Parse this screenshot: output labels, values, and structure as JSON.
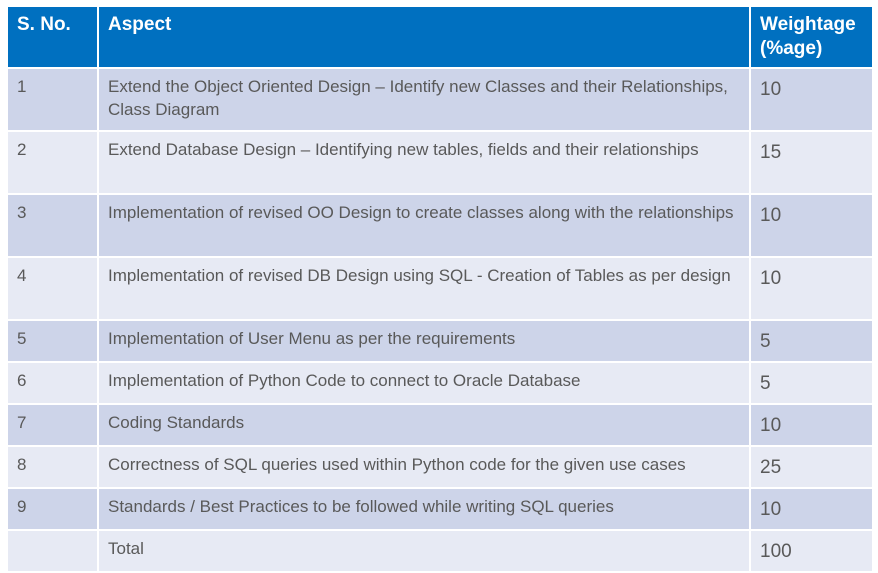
{
  "table": {
    "headers": {
      "sno": "S. No.",
      "aspect": "Aspect",
      "weightage_line1": "Weightage",
      "weightage_line2": "(%age)"
    },
    "rows": [
      {
        "sno": "1",
        "aspect": "Extend the Object Oriented Design – Identify new Classes and their Relationships, Class Diagram",
        "weight": "10"
      },
      {
        "sno": "2",
        "aspect": "Extend Database Design – Identifying new tables, fields and their relationships",
        "weight": "15"
      },
      {
        "sno": "3",
        "aspect": "Implementation of revised OO Design to create classes along with the relationships",
        "weight": "10"
      },
      {
        "sno": "4",
        "aspect": "Implementation of revised DB Design using SQL - Creation of Tables as per design",
        "weight": "10"
      },
      {
        "sno": "5",
        "aspect": "Implementation of User Menu as per the requirements",
        "weight": "5"
      },
      {
        "sno": "6",
        "aspect": "Implementation of Python Code to connect to Oracle Database",
        "weight": "5"
      },
      {
        "sno": "7",
        "aspect": "Coding Standards",
        "weight": "10"
      },
      {
        "sno": "8",
        "aspect": "Correctness of SQL queries used within Python code for the given use cases",
        "weight": "25"
      },
      {
        "sno": "9",
        "aspect": "Standards / Best Practices to be followed while writing SQL queries",
        "weight": "10"
      }
    ],
    "total": {
      "sno": "",
      "label": "Total",
      "weight": "100"
    }
  },
  "colors": {
    "header_bg": "#0070c0",
    "row_odd_bg": "#cdd4e9",
    "row_even_bg": "#e7eaf4",
    "text": "#595959"
  }
}
